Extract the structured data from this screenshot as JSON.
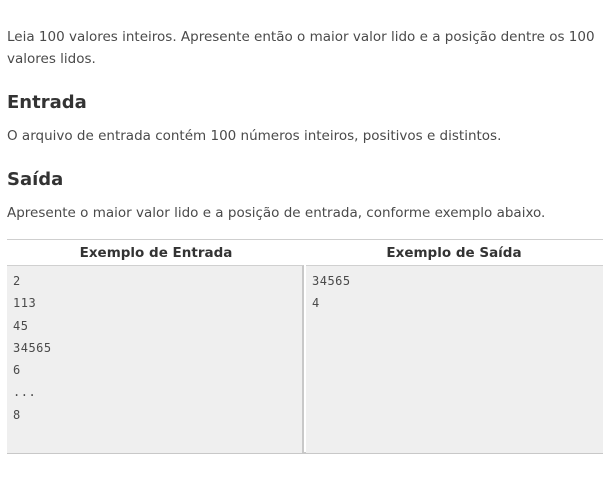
{
  "intro": {
    "text": "Leia 100 valores inteiros. Apresente então o maior valor lido e a posição dentre os 100 valores lidos."
  },
  "entrada": {
    "heading": "Entrada",
    "text": "O arquivo de entrada contém 100 números inteiros, positivos e distintos."
  },
  "saida": {
    "heading": "Saída",
    "text": "Apresente o maior valor lido e a posição de entrada, conforme exemplo abaixo."
  },
  "example": {
    "input_header": "Exemplo de Entrada",
    "output_header": "Exemplo de Saída",
    "input_lines": [
      "2",
      "113",
      "45",
      "34565",
      "6",
      "...",
      "8"
    ],
    "output_lines": [
      "34565",
      "4"
    ]
  }
}
